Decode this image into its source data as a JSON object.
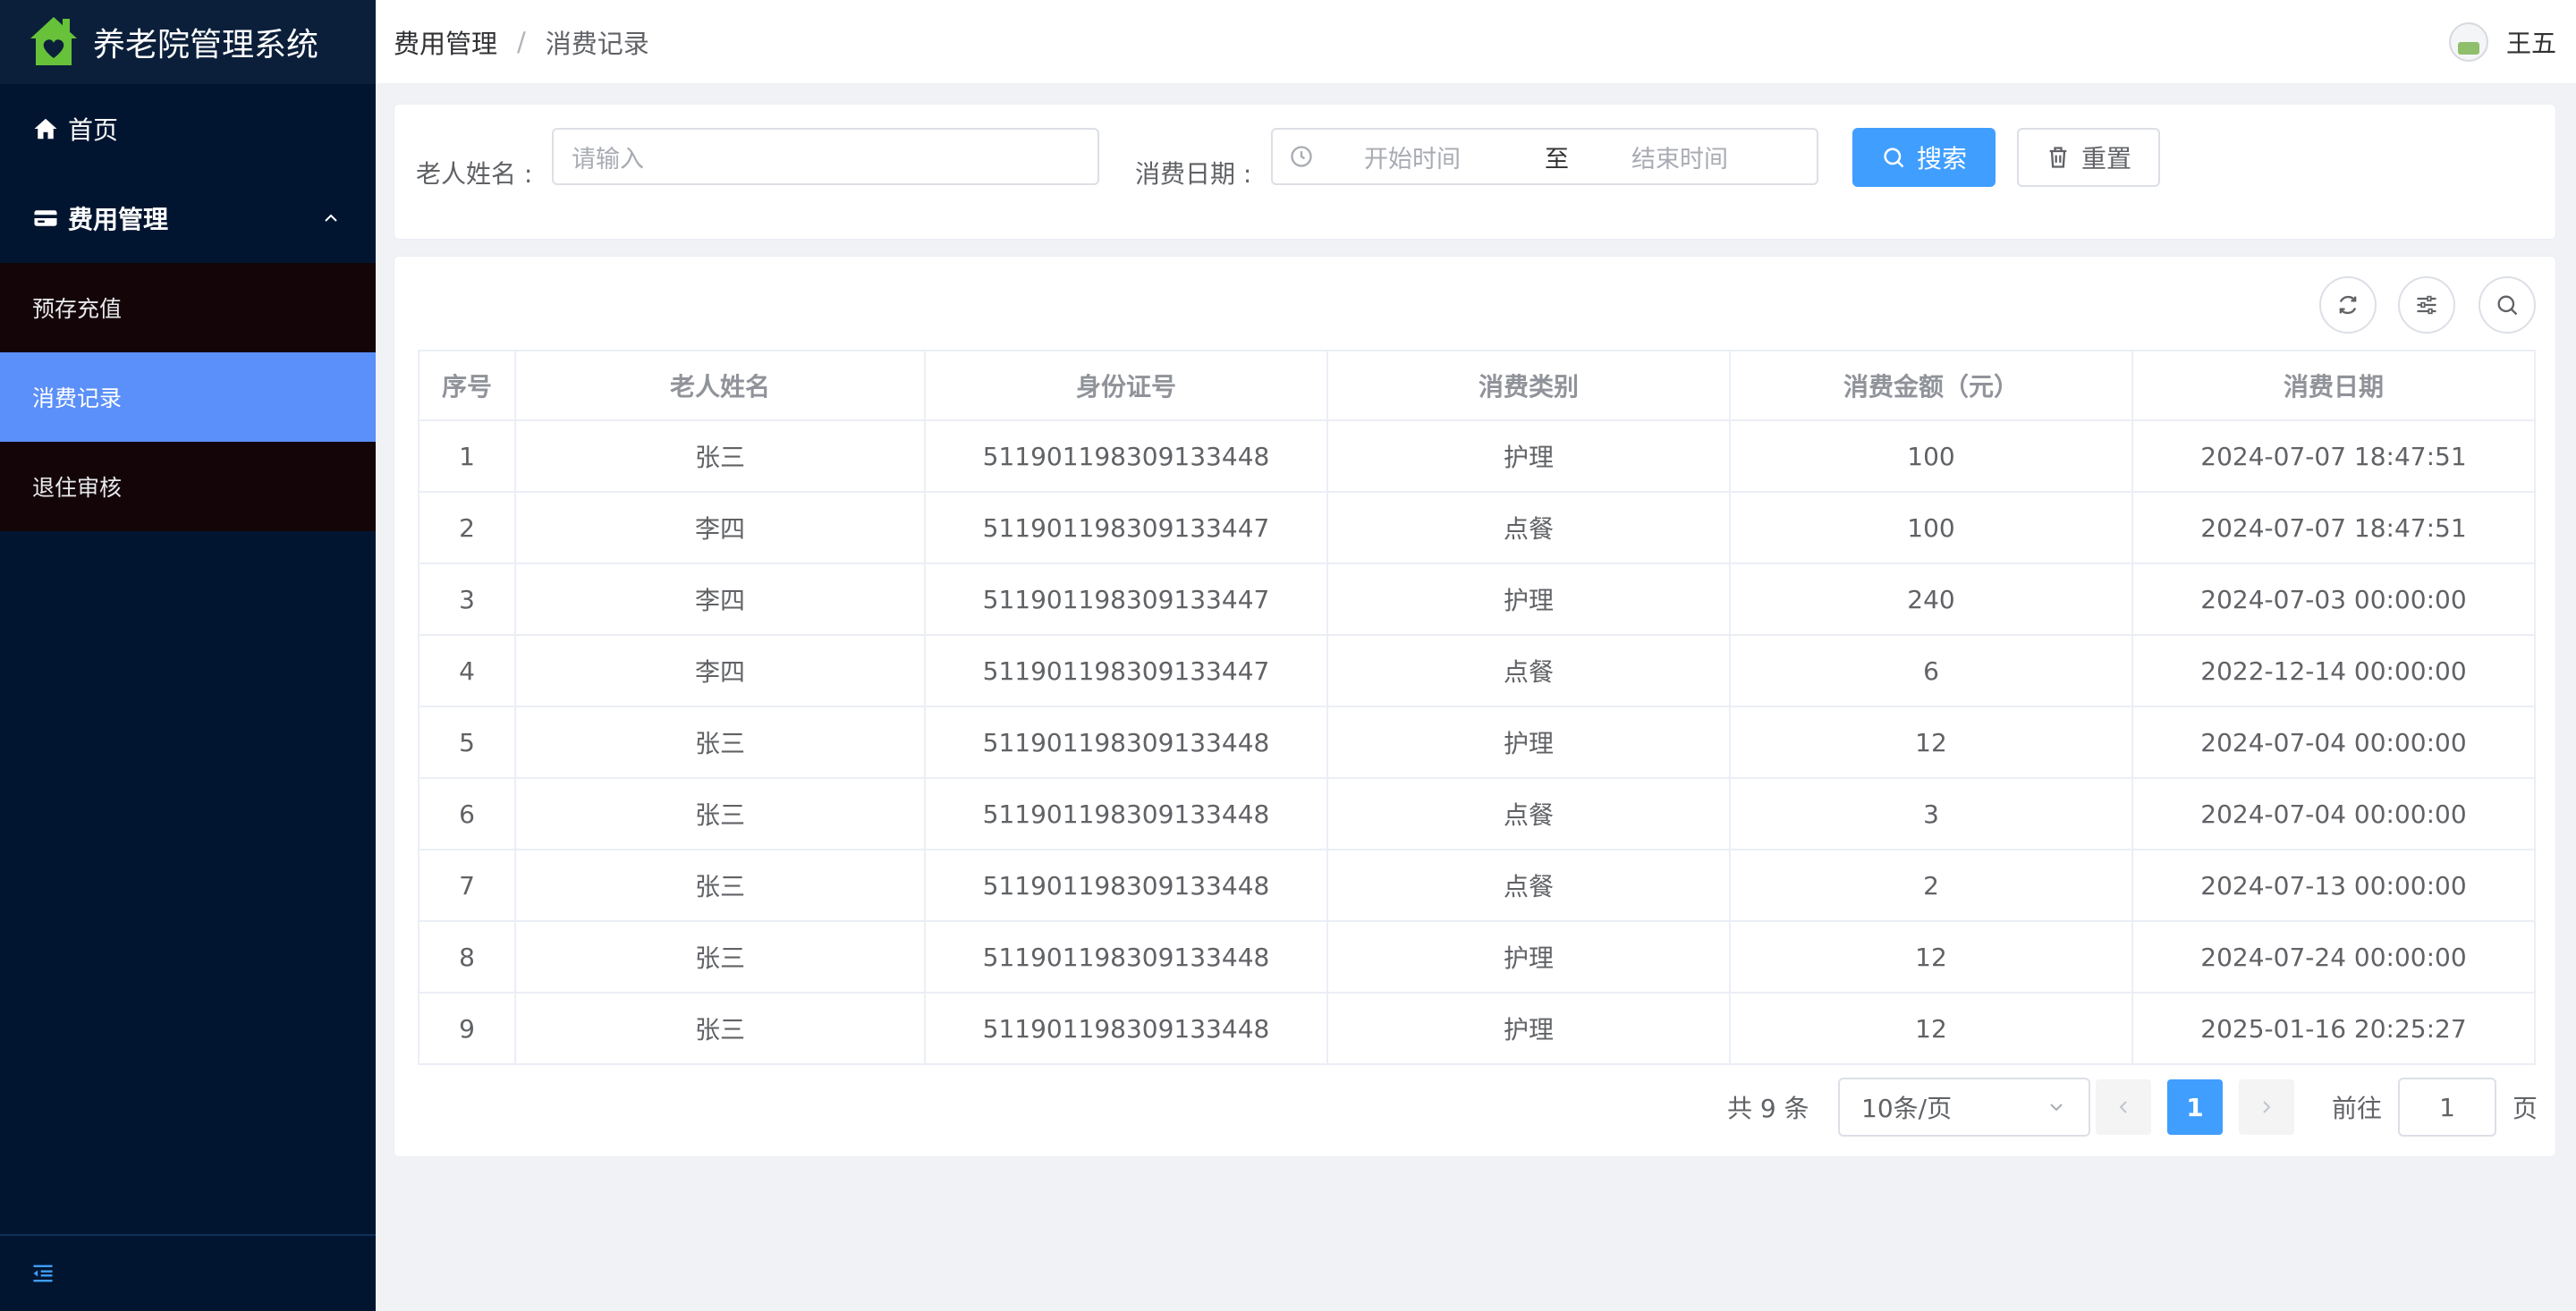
{
  "app": {
    "title": "养老院管理系统"
  },
  "sidebar": {
    "home_label": "首页",
    "group_label": "费用管理",
    "sub_items": [
      {
        "label": "预存充值",
        "active": false
      },
      {
        "label": "消费记录",
        "active": true
      },
      {
        "label": "退住审核",
        "active": false
      }
    ]
  },
  "header": {
    "breadcrumb": [
      "费用管理",
      "消费记录"
    ],
    "separator": "/",
    "user_name": "王五"
  },
  "search": {
    "name_label": "老人姓名 :",
    "name_placeholder": "请输入",
    "date_label": "消费日期 :",
    "start_placeholder": "开始时间",
    "range_separator": "至",
    "end_placeholder": "结束时间",
    "search_button": "搜索",
    "reset_button": "重置"
  },
  "table": {
    "columns": [
      "序号",
      "老人姓名",
      "身份证号",
      "消费类别",
      "消费金额（元）",
      "消费日期"
    ],
    "rows": [
      [
        "1",
        "张三",
        "511901198309133448",
        "护理",
        "100",
        "2024-07-07 18:47:51"
      ],
      [
        "2",
        "李四",
        "511901198309133447",
        "点餐",
        "100",
        "2024-07-07 18:47:51"
      ],
      [
        "3",
        "李四",
        "511901198309133447",
        "护理",
        "240",
        "2024-07-03 00:00:00"
      ],
      [
        "4",
        "李四",
        "511901198309133447",
        "点餐",
        "6",
        "2022-12-14 00:00:00"
      ],
      [
        "5",
        "张三",
        "511901198309133448",
        "护理",
        "12",
        "2024-07-04 00:00:00"
      ],
      [
        "6",
        "张三",
        "511901198309133448",
        "点餐",
        "3",
        "2024-07-04 00:00:00"
      ],
      [
        "7",
        "张三",
        "511901198309133448",
        "点餐",
        "2",
        "2024-07-13 00:00:00"
      ],
      [
        "8",
        "张三",
        "511901198309133448",
        "护理",
        "12",
        "2024-07-24 00:00:00"
      ],
      [
        "9",
        "张三",
        "511901198309133448",
        "护理",
        "12",
        "2025-01-16 20:25:27"
      ]
    ]
  },
  "pagination": {
    "total_text": "共 9 条",
    "page_size": "10条/页",
    "current_page": "1",
    "goto_label": "前往",
    "goto_value": "1",
    "goto_suffix": "页"
  },
  "colors": {
    "sidebar_bg": "#021530",
    "active_item": "#5b8ff9",
    "primary": "#409eff"
  }
}
